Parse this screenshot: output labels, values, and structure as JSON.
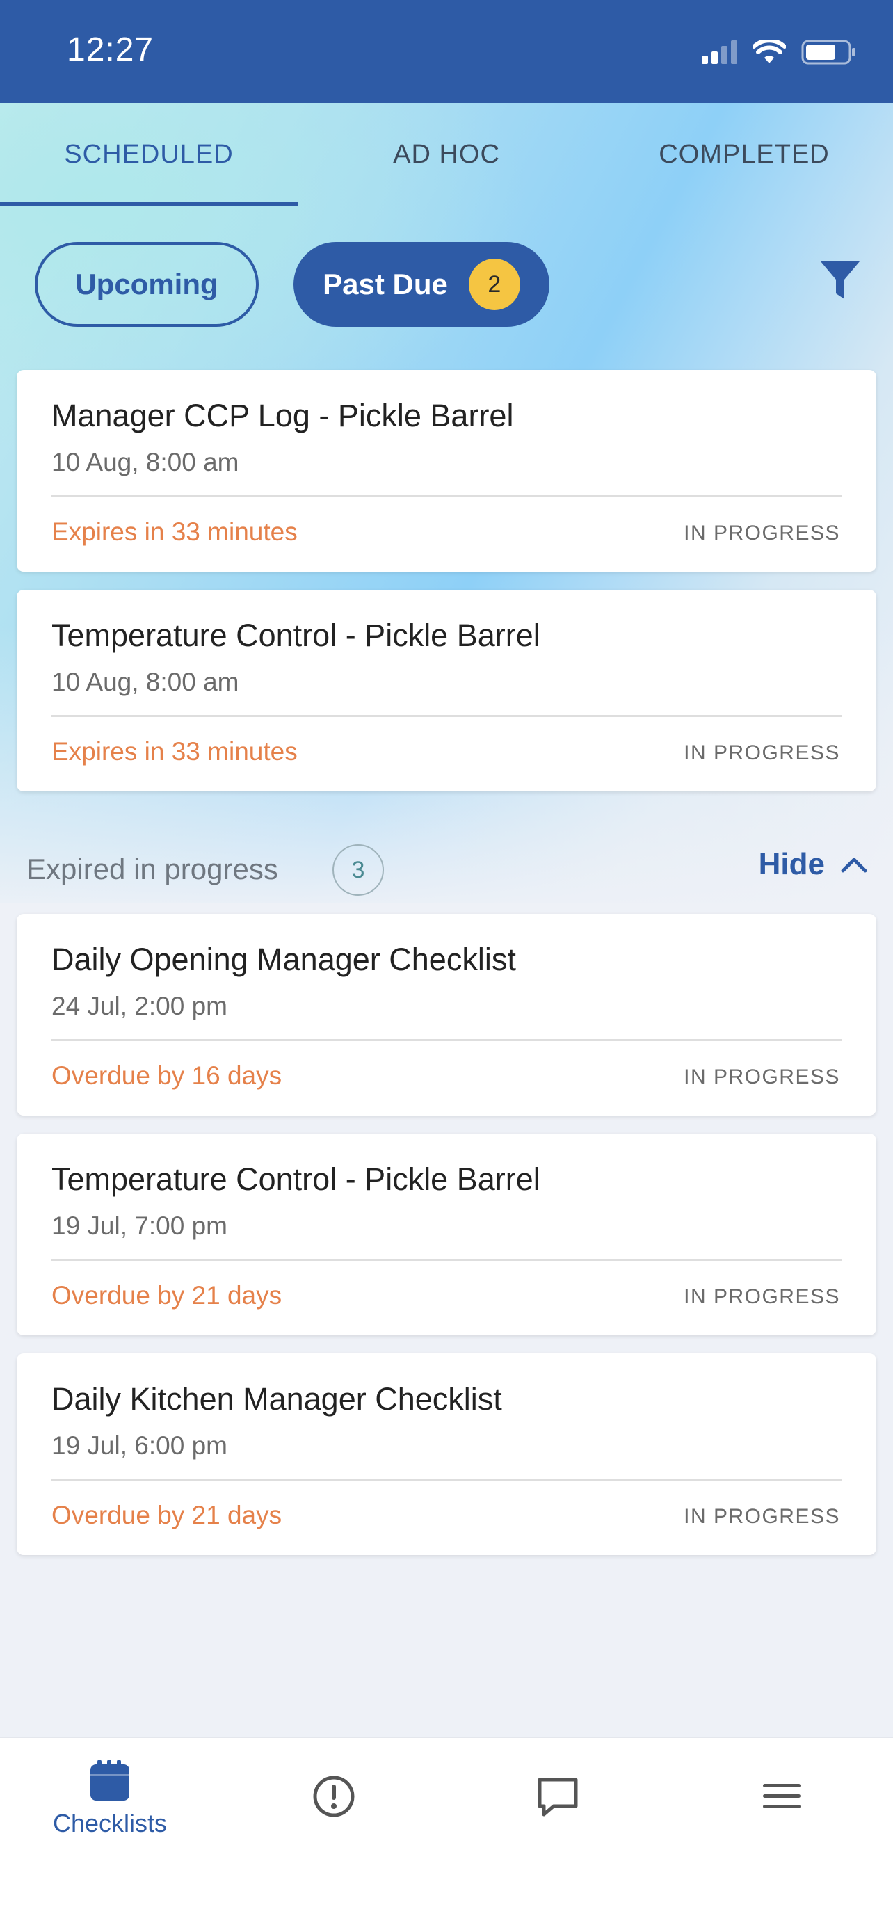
{
  "status_bar": {
    "time": "12:27"
  },
  "tabs": [
    {
      "label": "SCHEDULED"
    },
    {
      "label": "AD HOC"
    },
    {
      "label": "COMPLETED"
    }
  ],
  "filters": {
    "upcoming_label": "Upcoming",
    "past_due_label": "Past Due",
    "past_due_count": "2"
  },
  "cards": [
    {
      "title": "Manager CCP Log - Pickle Barrel",
      "date": "10 Aug, 8:00 am",
      "status_time": "Expires in 33 minutes",
      "status": "IN PROGRESS"
    },
    {
      "title": "Temperature Control - Pickle Barrel",
      "date": "10 Aug, 8:00 am",
      "status_time": "Expires in 33 minutes",
      "status": "IN PROGRESS"
    }
  ],
  "expired_section": {
    "title": "Expired in progress",
    "count": "3",
    "hide_label": "Hide"
  },
  "expired_cards": [
    {
      "title": "Daily Opening Manager Checklist",
      "date": "24 Jul, 2:00 pm",
      "status_time": "Overdue by 16 days",
      "status": "IN PROGRESS"
    },
    {
      "title": "Temperature Control - Pickle Barrel",
      "date": "19 Jul, 7:00 pm",
      "status_time": "Overdue by 21 days",
      "status": "IN PROGRESS"
    },
    {
      "title": "Daily Kitchen Manager Checklist",
      "date": "19 Jul, 6:00 pm",
      "status_time": "Overdue by 21 days",
      "status": "IN PROGRESS"
    }
  ],
  "bottom_nav": {
    "checklists_label": "Checklists",
    "icons": [
      "calendar-icon",
      "alert-circle-icon",
      "chat-icon",
      "menu-icon"
    ]
  },
  "colors": {
    "brand": "#2e5ba6",
    "badge": "#f5c542",
    "warning_text": "#e5814a"
  }
}
